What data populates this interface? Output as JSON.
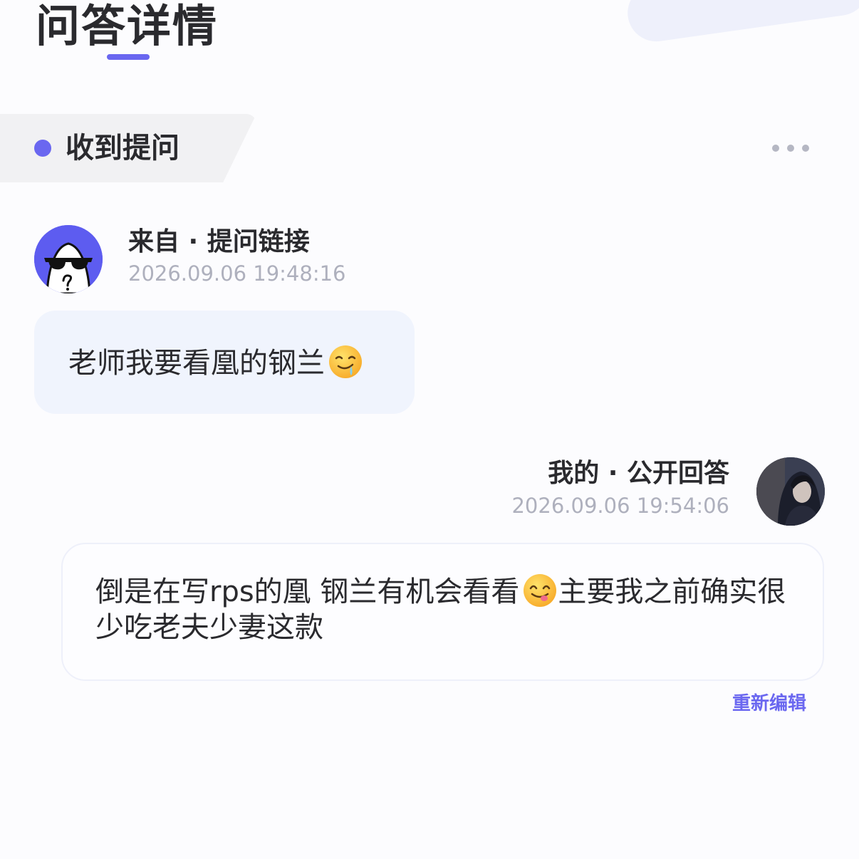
{
  "header": {
    "title": "问答详情"
  },
  "section": {
    "label": "收到提问"
  },
  "question": {
    "source": "来自 · 提问链接",
    "time": "2026.09.06 19:48:16",
    "text": "老师我要看凰的钢兰",
    "emoji": "drooling-face"
  },
  "answer": {
    "label": "我的 · 公开回答",
    "time": "2026.09.06 19:54:06",
    "text_part1": "倒是在写rps的凰 钢兰有机会看看",
    "emoji": "savoring-face",
    "text_part2": "主要我之前确实很少吃老夫少妻这款",
    "edit_label": "重新编辑"
  },
  "colors": {
    "accent": "#6a67f0",
    "question_bubble": "#f0f4fd",
    "timestamp": "#aeb0bd"
  }
}
